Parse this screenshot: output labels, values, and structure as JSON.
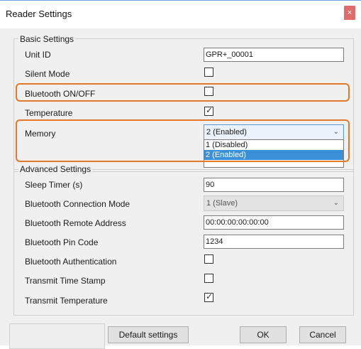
{
  "window": {
    "title": "Reader Settings",
    "close_glyph": "×"
  },
  "basic": {
    "title": "Basic Settings",
    "unit_id": {
      "label": "Unit ID",
      "value": "GPR+_00001"
    },
    "silent_mode": {
      "label": "Silent Mode",
      "checked": false
    },
    "bluetooth_onoff": {
      "label": "Bluetooth ON/OFF",
      "checked": false
    },
    "temperature": {
      "label": "Temperature",
      "checked": true,
      "check_glyph": "✓"
    },
    "memory": {
      "label": "Memory",
      "selected": "2 (Enabled)",
      "options": [
        "1 (Disabled)",
        "2 (Enabled)"
      ],
      "chevron": "⌄"
    }
  },
  "advanced": {
    "title": "Advanced Settings",
    "sleep_timer": {
      "label": "Sleep Timer (s)",
      "value": "90"
    },
    "bt_connection_mode": {
      "label": "Bluetooth Connection Mode",
      "selected": "1 (Slave)",
      "chevron": "⌄"
    },
    "bt_remote_address": {
      "label": "Bluetooth Remote Address",
      "value": "00:00:00:00:00:00"
    },
    "bt_pin_code": {
      "label": "Bluetooth Pin Code",
      "value": "1234"
    },
    "bt_authentication": {
      "label": "Bluetooth Authentication",
      "checked": false
    },
    "transmit_time_stamp": {
      "label": "Transmit Time Stamp",
      "checked": false
    },
    "transmit_temperature": {
      "label": "Transmit Temperature",
      "checked": true,
      "check_glyph": "✓"
    }
  },
  "buttons": {
    "default_settings": "Default settings",
    "ok": "OK",
    "cancel": "Cancel"
  },
  "colors": {
    "highlight": "#e07a2a",
    "selection": "#3a8fd6",
    "close": "#e06b6b"
  }
}
